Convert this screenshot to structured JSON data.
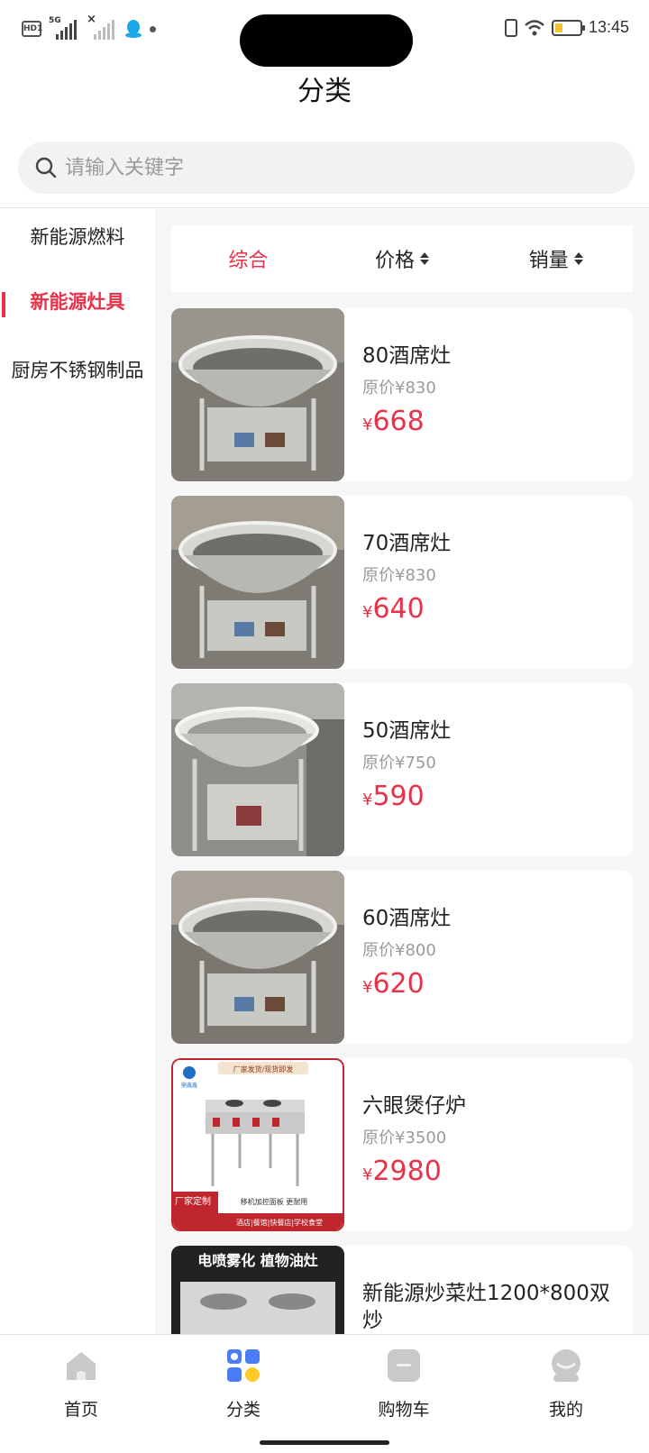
{
  "status_bar": {
    "network_badge": "HD1",
    "signal_label": "5G",
    "time": "13:45",
    "battery_level": 0.3
  },
  "header": {
    "title": "分类"
  },
  "search": {
    "placeholder": "请输入关键字",
    "value": ""
  },
  "categories": [
    {
      "label": "新能源燃料",
      "active": false
    },
    {
      "label": "新能源灶具",
      "active": true
    },
    {
      "label": "厨房不锈钢制品",
      "active": false
    }
  ],
  "sort_tabs": [
    {
      "label": "综合",
      "active": true
    },
    {
      "label": "价格",
      "active": false
    },
    {
      "label": "销量",
      "active": false
    }
  ],
  "products": [
    {
      "name": "80酒席灶",
      "original_price": "原价¥830",
      "currency": "¥",
      "price": "668"
    },
    {
      "name": "70酒席灶",
      "original_price": "原价¥830",
      "currency": "¥",
      "price": "640"
    },
    {
      "name": "50酒席灶",
      "original_price": "原价¥750",
      "currency": "¥",
      "price": "590"
    },
    {
      "name": "60酒席灶",
      "original_price": "原价¥800",
      "currency": "¥",
      "price": "620"
    },
    {
      "name": "六眼煲仔炉",
      "original_price": "原价¥3500",
      "currency": "¥",
      "price": "2980",
      "image_text": {
        "top": "厂家发货/现货即发",
        "brand": "鼎鑫鑫",
        "corner": "厂家定制",
        "bottom1": "移机加控面板 更耐用",
        "bottom2": "酒店|餐馆|快餐店|学校食堂"
      }
    },
    {
      "name": "新能源炒菜灶1200*800双炒",
      "original_price": "",
      "currency": "",
      "price": "",
      "image_text": {
        "banner": "电喷雾化 植物油灶"
      }
    }
  ],
  "tab_bar": [
    {
      "label": "首页",
      "icon": "home-icon"
    },
    {
      "label": "分类",
      "icon": "category-icon"
    },
    {
      "label": "购物车",
      "icon": "cart-icon"
    },
    {
      "label": "我的",
      "icon": "profile-icon"
    }
  ],
  "colors": {
    "accent": "#e8324a",
    "panel_bg": "#f6f6f6"
  }
}
